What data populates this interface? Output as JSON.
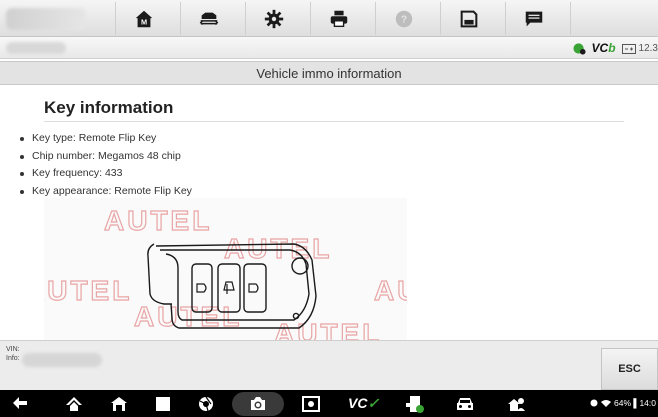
{
  "toolbar": {
    "buttons": [
      {
        "name": "home",
        "icon": "home-icon"
      },
      {
        "name": "vehicle-swap",
        "icon": "car-swap-icon"
      },
      {
        "name": "settings",
        "icon": "gear-icon"
      },
      {
        "name": "print",
        "icon": "printer-icon"
      },
      {
        "name": "help",
        "icon": "help-icon"
      },
      {
        "name": "save",
        "icon": "save-icon"
      },
      {
        "name": "data-logging",
        "icon": "message-icon"
      }
    ]
  },
  "status": {
    "vcb_prefix": "VC",
    "vcb_suffix": "b",
    "battery": "12.3"
  },
  "page": {
    "title": "Vehicle immo information",
    "heading": "Key information",
    "bullets": [
      "Key type: Remote Flip Key",
      "Chip number: Megamos 48 chip",
      "Key frequency: 433",
      "Key appearance: Remote Flip Key"
    ],
    "watermark": "AUTEL"
  },
  "footer": {
    "vin_label": "VIN:",
    "info_label": "Info:",
    "esc_label": "ESC"
  },
  "navbar": {
    "vc_prefix": "VC",
    "system_status": "64% ▌14:0"
  },
  "colors": {
    "accent_green": "#3aa335",
    "watermark_red": "#e8a0a0"
  }
}
